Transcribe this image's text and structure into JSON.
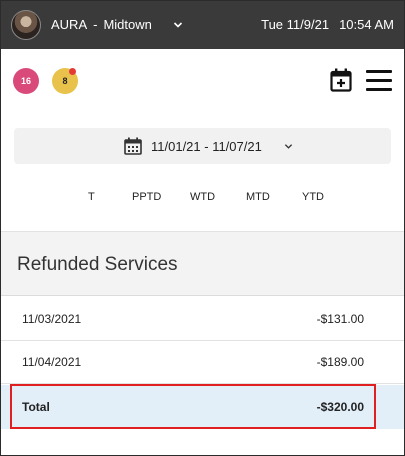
{
  "topbar": {
    "brand": "AURA",
    "separator": "-",
    "location": "Midtown",
    "date": "Tue 11/9/21",
    "time": "10:54 AM"
  },
  "badges": {
    "pink_count": "16",
    "yellow_count": "8"
  },
  "date_range": {
    "label": "11/01/21 - 11/07/21"
  },
  "tabs": [
    {
      "label": "T"
    },
    {
      "label": "PPTD"
    },
    {
      "label": "WTD"
    },
    {
      "label": "MTD"
    },
    {
      "label": "YTD"
    }
  ],
  "section": {
    "title": "Refunded Services"
  },
  "rows": [
    {
      "date": "11/03/2021",
      "amount": "-$131.00"
    },
    {
      "date": "11/04/2021",
      "amount": "-$189.00"
    }
  ],
  "total": {
    "label": "Total",
    "amount": "-$320.00"
  },
  "colors": {
    "topbar": "#3a3a3a",
    "badge_pink": "#d94a7a",
    "badge_yellow": "#e8c24a",
    "total_row": "#e3eff8",
    "highlight": "#e02020"
  }
}
